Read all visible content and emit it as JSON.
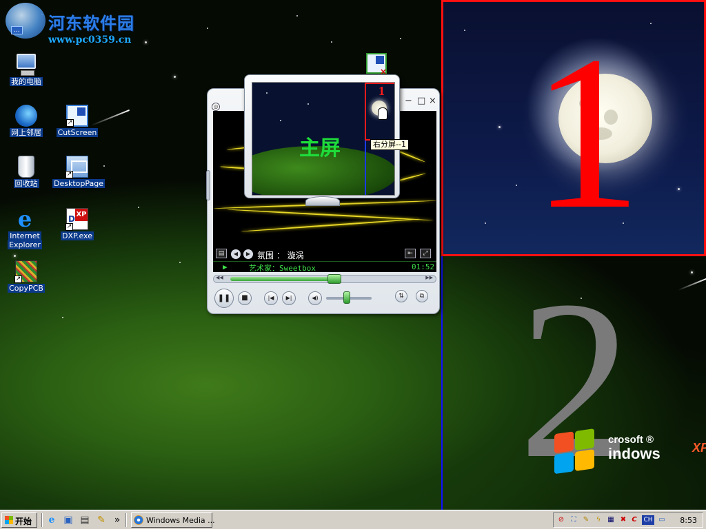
{
  "watermark": {
    "title": "河东软件园",
    "url": "www.pc0359.cn",
    "tag": "..."
  },
  "desktop_icons": [
    {
      "id": "my-computer",
      "label": "我的电脑",
      "icon": "computer-icon"
    },
    {
      "id": "network",
      "label": "网上邻居",
      "icon": "network-icon"
    },
    {
      "id": "cutscreen",
      "label": "CutScreen",
      "icon": "cutscreen-icon"
    },
    {
      "id": "recycle-bin",
      "label": "回收站",
      "icon": "recycle-bin-icon"
    },
    {
      "id": "desktoppage",
      "label": "DesktopPage",
      "icon": "desktoppage-icon"
    },
    {
      "id": "ie",
      "label_line1": "Internet",
      "label_line2": "Explorer",
      "icon": "internet-explorer-icon"
    },
    {
      "id": "dxp",
      "label": "DXP.exe",
      "icon": "dxp-icon",
      "glyph_dx": "D",
      "glyph_xp": "XP"
    },
    {
      "id": "copypcb",
      "label": "CopyPCB",
      "icon": "copypcb-icon"
    }
  ],
  "split_screens": {
    "right_top_number": "1",
    "right_bottom_number": "2",
    "border_colors": {
      "top": "#ff1010",
      "bottom": "#1010ff"
    }
  },
  "xp_logo": {
    "line1": "crosoft ®",
    "line2": "indows",
    "suffix": "XP"
  },
  "overview": {
    "main_label": "主屏",
    "mini_number": "1",
    "tooltip": "右分屏--1"
  },
  "media_player": {
    "window_controls": {
      "minimize": "−",
      "maximize": "□",
      "close": "×"
    },
    "menu_button": "◎",
    "info_label": "氛围 ： 漩涡",
    "artist_label": "艺术家：Sweetbox",
    "time": "01:52",
    "play_indicator": "▶",
    "seek_progress": 0.55,
    "volume_level": 0.45,
    "buttons": {
      "pause": "❚❚",
      "stop": "■",
      "prev": "|◀",
      "next": "▶|",
      "mute": "◀)",
      "shuffle": "⇅",
      "switch_mode": "⧉",
      "prev_visual": "◀",
      "next_visual": "▶",
      "seek_back": "◀◀",
      "seek_fwd": "▶▶"
    }
  },
  "taskbar": {
    "start_label": "开始",
    "quick_launch_overflow": "»",
    "task_items": [
      {
        "label": "Windows Media ...",
        "icon": "media-player-icon"
      }
    ],
    "tray_icons": [
      "antivirus-icon",
      "network-tray-icon",
      "pen-icon",
      "lightning-icon",
      "network-status-icon",
      "close-red-icon",
      "c-tool-icon",
      "ch-lang-icon",
      "display-icon"
    ],
    "lang": "CH",
    "clock": "8:53"
  }
}
